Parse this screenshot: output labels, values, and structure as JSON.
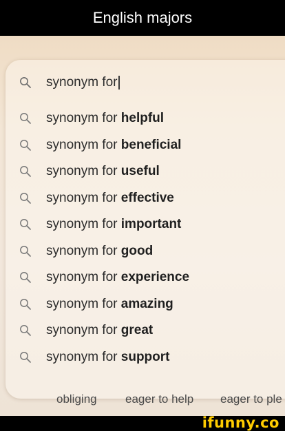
{
  "caption": "English majors",
  "search": {
    "query": "synonym for",
    "suggestion_prefix": "synonym for",
    "suggestions": [
      "helpful",
      "beneficial",
      "useful",
      "effective",
      "important",
      "good",
      "experience",
      "amazing",
      "great",
      "support"
    ]
  },
  "related": [
    "obliging",
    "eager to help",
    "eager to ple"
  ],
  "watermark": "ifunny.co",
  "colors": {
    "logo": "#ffcc00",
    "text": "#2a2a2a",
    "background": "#f2e7dc"
  },
  "icons": {
    "search": "search-icon"
  }
}
